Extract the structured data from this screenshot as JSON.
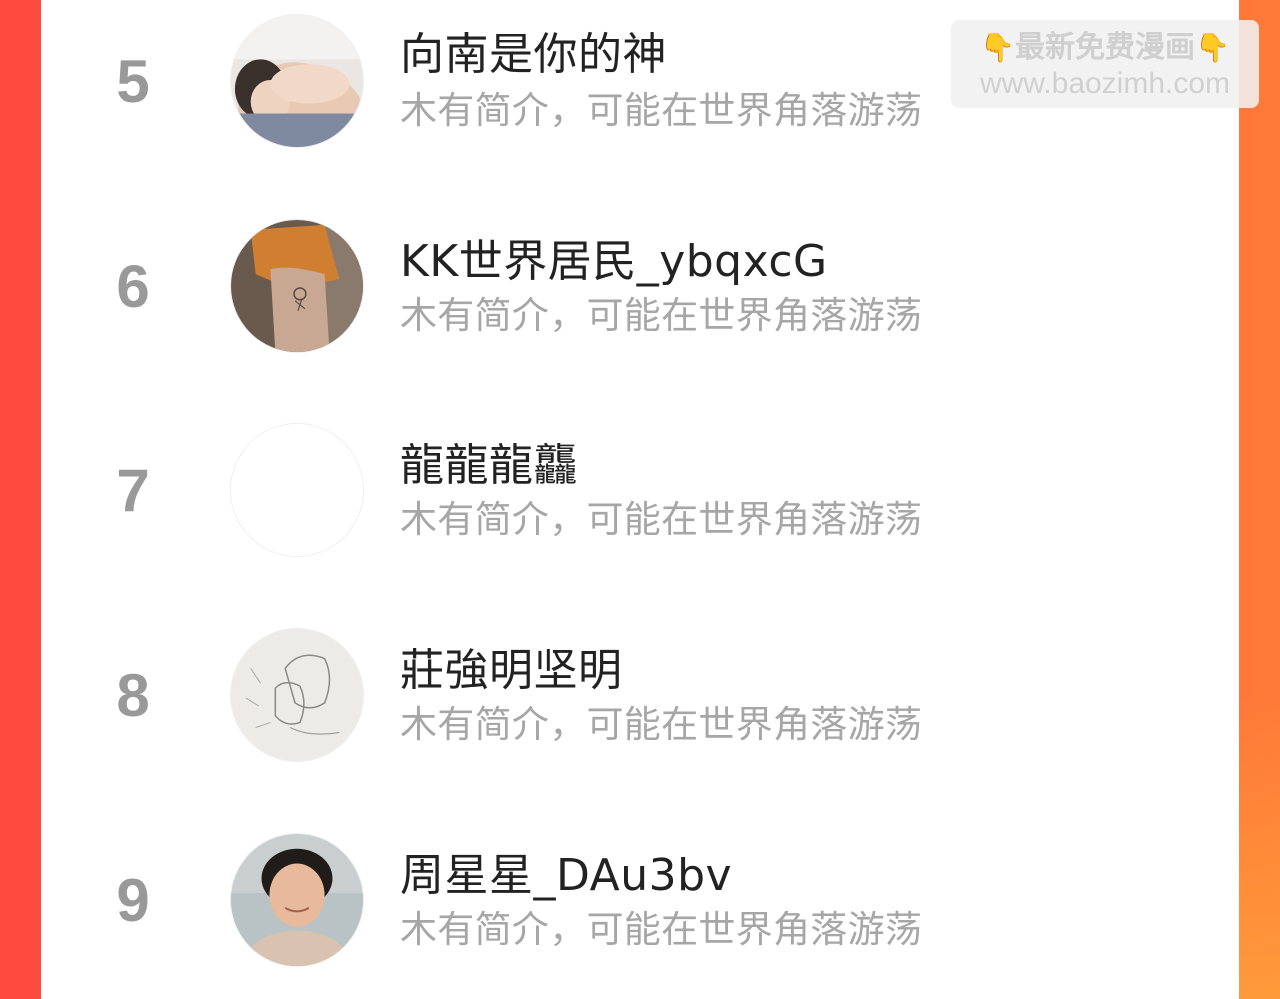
{
  "ranking": {
    "items": [
      {
        "rank": "5",
        "name": "向南是你的神",
        "desc": "木有简介，可能在世界角落游荡",
        "avatar": "portrait-photo"
      },
      {
        "rank": "6",
        "name": "KK世界居民_ybqxcG",
        "desc": "木有简介，可能在世界角落游荡",
        "avatar": "tattoo-arm-photo"
      },
      {
        "rank": "7",
        "name": "龍龍龍龘",
        "desc": "木有简介，可能在世界角落游荡",
        "avatar": "blank-avatar"
      },
      {
        "rank": "8",
        "name": "莊強明坚明",
        "desc": "木有简介，可能在世界角落游荡",
        "avatar": "sketch-drawing"
      },
      {
        "rank": "9",
        "name": "周星星_DAu3bv",
        "desc": "木有简介，可能在世界角落游荡",
        "avatar": "portrait-photo"
      }
    ]
  },
  "watermark": {
    "hand_left": "👇",
    "title": "最新免费漫画",
    "hand_right": "👇",
    "url": "www.baozimh.com"
  },
  "colors": {
    "background_left": "#ff4a3f",
    "background_right": "#ff7a38",
    "rank_number": "#999999",
    "name_text": "#222222",
    "desc_text": "#a6a6a6"
  }
}
